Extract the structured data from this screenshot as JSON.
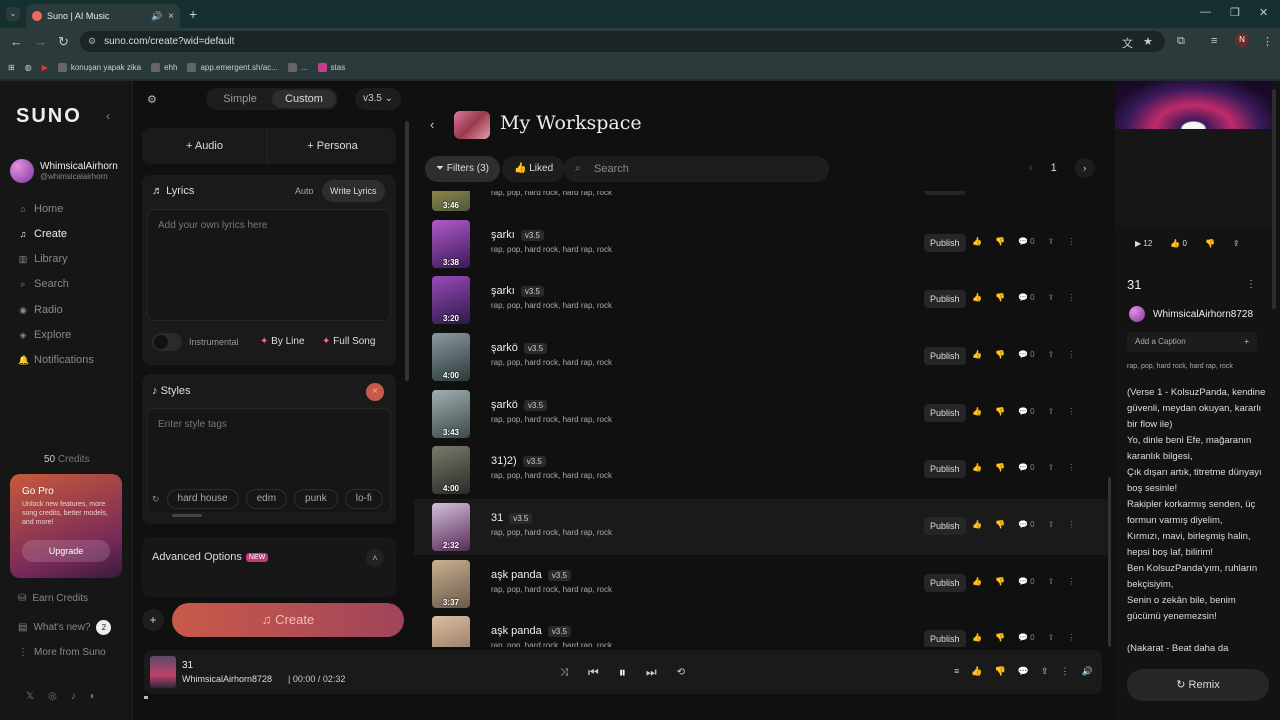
{
  "browser": {
    "tab_title": "Suno | AI Music",
    "url": "suno.com/create?wid=default",
    "profile_initial": "N",
    "bookmarks": [
      "konuşan yapak zika",
      "ehh",
      "app.emergent.sh/ac...",
      "...",
      "stas"
    ]
  },
  "sidebar": {
    "logo": "SUNO",
    "user_name": "WhimsicalAirhorn",
    "user_handle": "@whimsicalairhorn",
    "nav": [
      {
        "label": "Home",
        "icon": "home-icon"
      },
      {
        "label": "Create",
        "icon": "music-note-icon"
      },
      {
        "label": "Library",
        "icon": "library-icon"
      },
      {
        "label": "Search",
        "icon": "search-icon"
      },
      {
        "label": "Radio",
        "icon": "radio-icon"
      },
      {
        "label": "Explore",
        "icon": "compass-icon"
      },
      {
        "label": "Notifications",
        "icon": "bell-icon"
      }
    ],
    "credits_value": "50",
    "credits_label": "Credits",
    "gopro_title": "Go Pro",
    "gopro_desc": "Unlock new features, more song credits, better models, and more!",
    "upgrade_label": "Upgrade",
    "earn_credits": "Earn Credits",
    "whats_new": "What's new?",
    "whats_new_count": "2",
    "more_from": "More from Suno"
  },
  "create": {
    "mode_simple": "Simple",
    "mode_custom": "Custom",
    "version": "v3.5",
    "audio_label": "+ Audio",
    "persona_label": "+ Persona",
    "lyrics_title": "Lyrics",
    "lyrics_auto": "Auto",
    "lyrics_write": "Write Lyrics",
    "lyrics_placeholder": "Add your own lyrics here",
    "instrumental": "Instrumental",
    "by_line": "By Line",
    "full_song": "Full Song",
    "styles_title": "Styles",
    "styles_placeholder": "Enter style tags",
    "style_chips": [
      "hard house",
      "edm",
      "punk",
      "lo-fi",
      "roc"
    ],
    "advanced": "Advanced Options",
    "new_badge": "NEW",
    "create_label": "Create"
  },
  "workspace": {
    "title": "My Workspace",
    "filters": "Filters (3)",
    "liked": "Liked",
    "search_placeholder": "Search",
    "page": "1",
    "songs": [
      {
        "title": "",
        "version": "",
        "tags": "rap, pop, hard rock, hard rap, rock",
        "duration": "3:46",
        "colors": [
          "#c7a65a",
          "#4a5a3a"
        ]
      },
      {
        "title": "şarkı",
        "version": "v3.5",
        "tags": "rap, pop, hard rock, hard rap, rock",
        "duration": "3:38",
        "colors": [
          "#b05ac8",
          "#3a1a5a"
        ]
      },
      {
        "title": "şarkı",
        "version": "v3.5",
        "tags": "rap, pop, hard rock, hard rap, rock",
        "duration": "3:20",
        "colors": [
          "#9a4ab8",
          "#2a1a4a"
        ]
      },
      {
        "title": "şarkö",
        "version": "v3.5",
        "tags": "rap, pop, hard rock, hard rap, rock",
        "duration": "4:00",
        "colors": [
          "#8a9aa0",
          "#2a3a3a"
        ]
      },
      {
        "title": "şarkö",
        "version": "v3.5",
        "tags": "rap, pop, hard rock, hard rap, rock",
        "duration": "3:43",
        "colors": [
          "#a0b0b0",
          "#3a4a4a"
        ]
      },
      {
        "title": "31)2)",
        "version": "v3.5",
        "tags": "rap, pop, hard rock, hard rap, rock",
        "duration": "4:00",
        "colors": [
          "#7a7a6a",
          "#2a2a2a"
        ]
      },
      {
        "title": "31",
        "version": "v3.5",
        "tags": "rap, pop, hard rock, hard rap, rock",
        "duration": "2:32",
        "colors": [
          "#d0c0d8",
          "#5a2a5a"
        ]
      },
      {
        "title": "aşk panda",
        "version": "v3.5",
        "tags": "rap, pop, hard rock, hard rap, rock",
        "duration": "3:37",
        "colors": [
          "#c8b090",
          "#6a5a4a"
        ]
      },
      {
        "title": "aşk panda",
        "version": "v3.5",
        "tags": "rap, pop, hard rock, hard rap, rock",
        "duration": "",
        "colors": [
          "#d8c0a0",
          "#8a6a5a"
        ]
      }
    ],
    "publish_label": "Publish",
    "comment_count": "0"
  },
  "detail": {
    "plays": "12",
    "likes": "0",
    "title": "31",
    "user": "WhimsicalAirhorn8728",
    "caption_placeholder": "Add a Caption",
    "tags": "rap, pop, hard rock, hard rap, rock",
    "lyrics": "(Verse 1 - KolsuzPanda, kendine güvenli, meydan okuyan, kararlı bir flow ile)\nYo, dinle beni Efe, mağaranın karanlık bilgesi,\nÇık dışarı artık, titretme dünyayı boş sesinle!\nRakipler korkarmış senden, üç formun varmış diyelim,\nKırmızı, mavi, birleşmiş halin, hepsi boş laf, bilirim!\nBen KolsuzPanda'yım, ruhların bekçisiyim,\nSenin o zekân bile, benim gücümü yenemezsin!\n\n(Nakarat - Beat daha da",
    "remix_label": "Remix"
  },
  "player": {
    "title": "31",
    "artist": "WhimsicalAirhorn8728",
    "time_current": "00:00",
    "time_total": "02:32"
  }
}
